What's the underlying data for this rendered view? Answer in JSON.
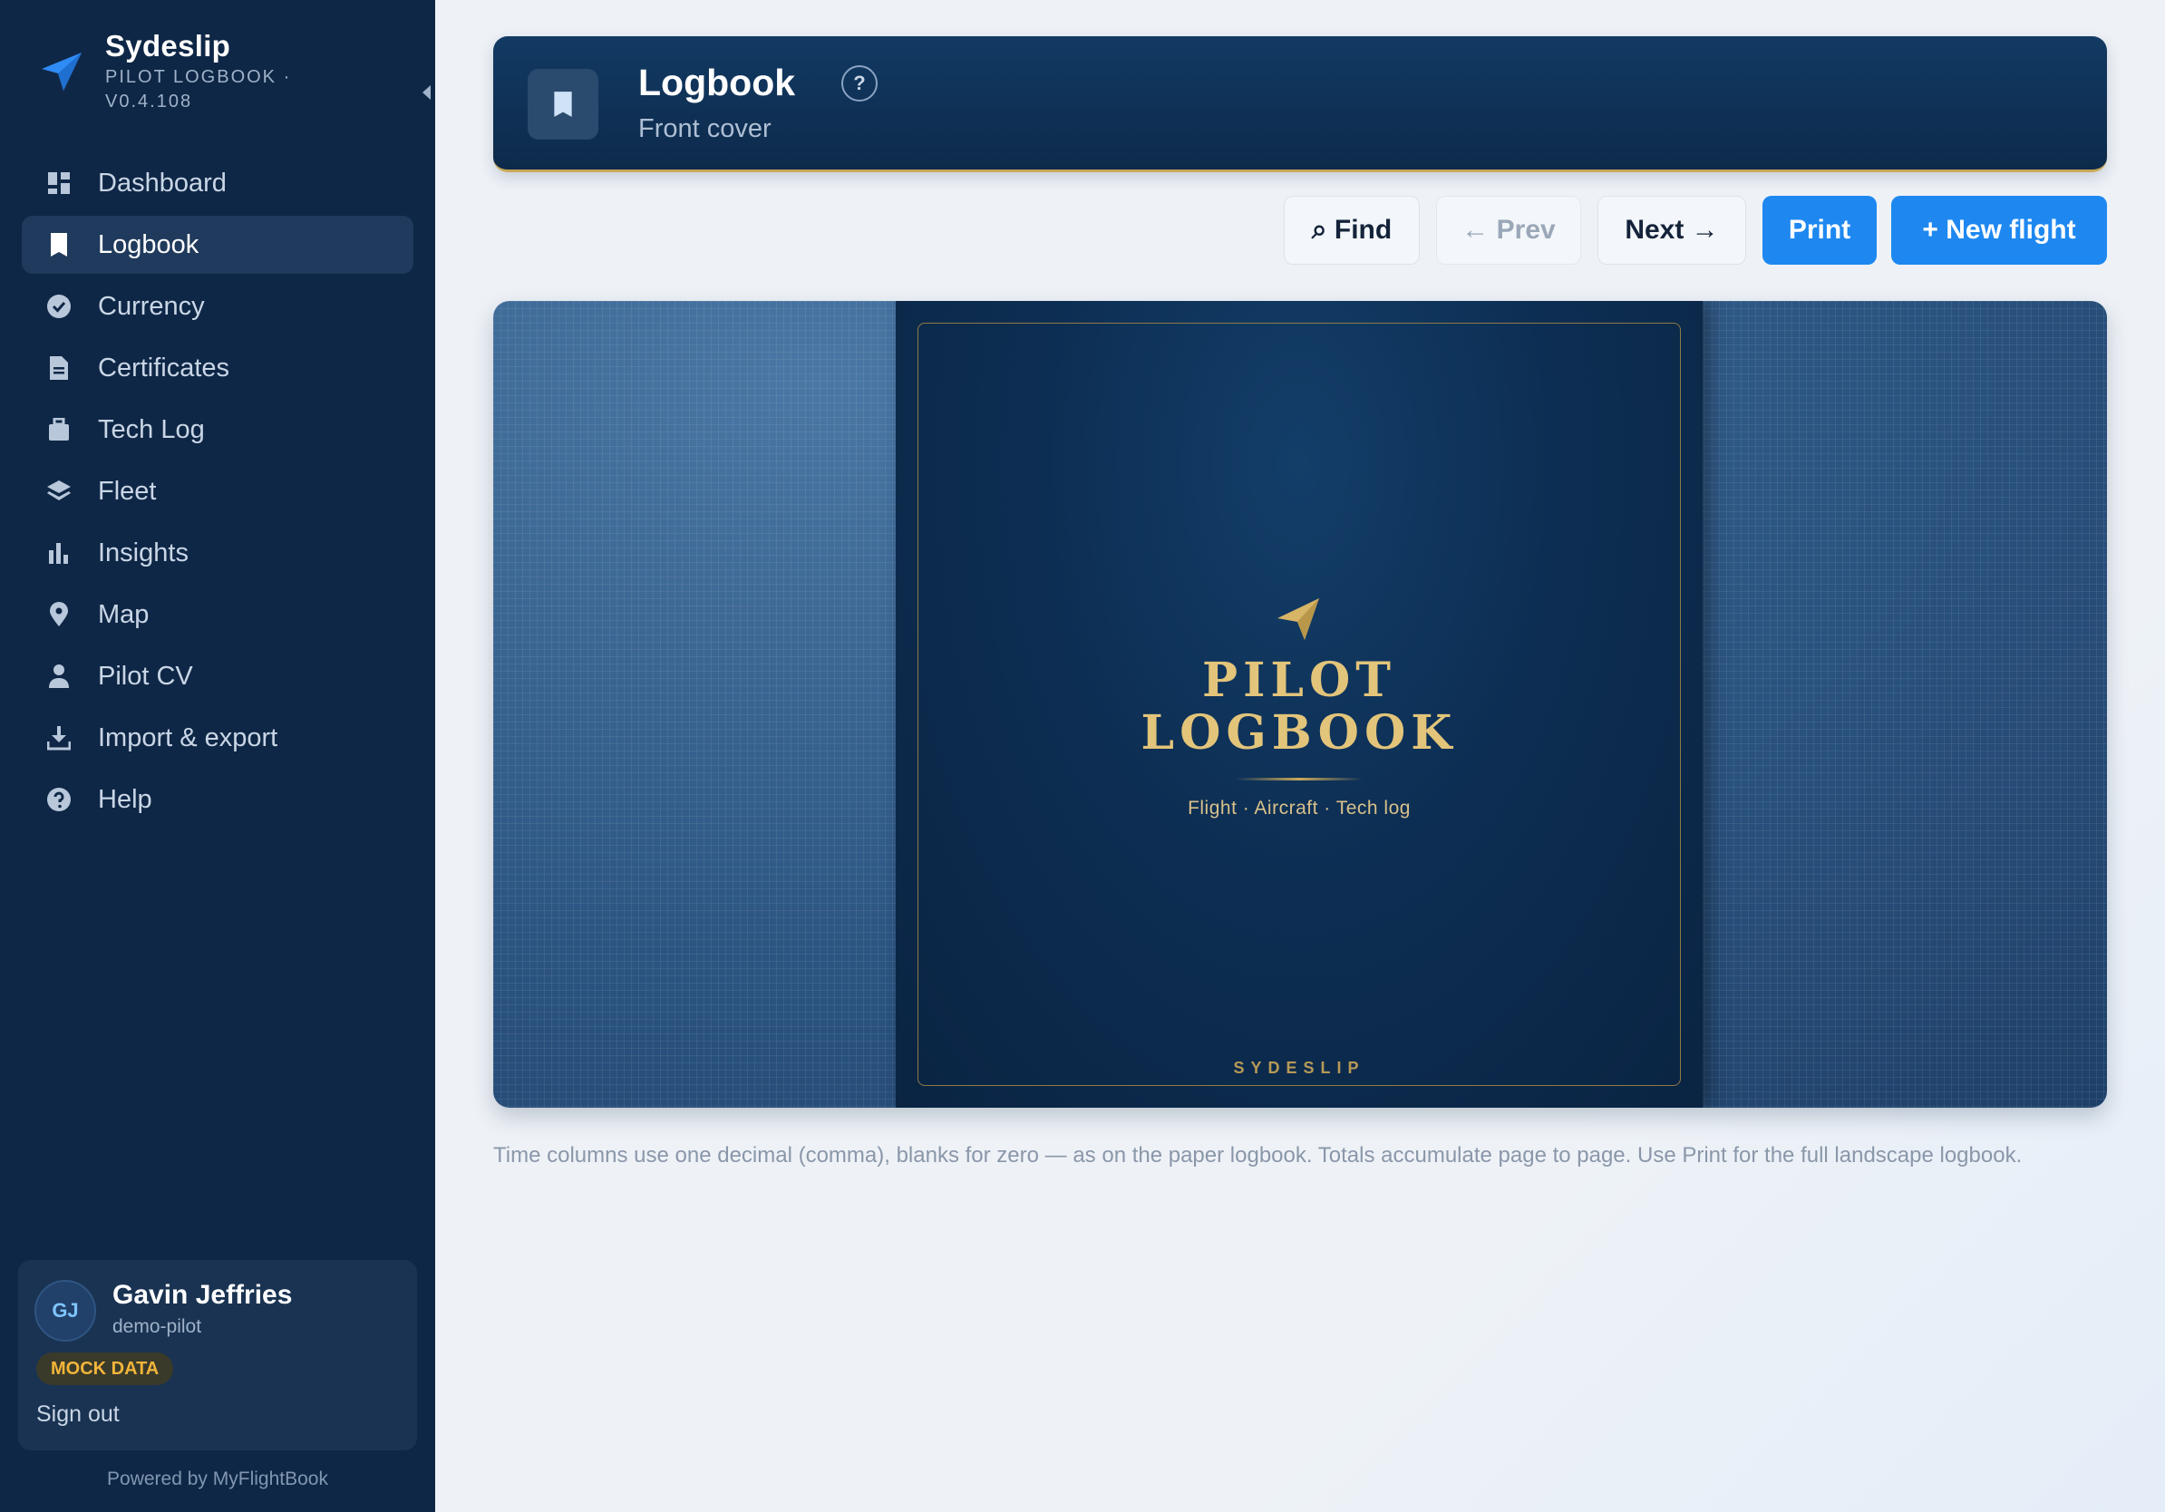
{
  "app": {
    "name": "Sydeslip",
    "subtitle": "PILOT LOGBOOK · V0.4.108",
    "powered_by": "Powered by MyFlightBook"
  },
  "sidebar": {
    "items": [
      {
        "label": "Dashboard",
        "icon": "dashboard-icon",
        "active": false
      },
      {
        "label": "Logbook",
        "icon": "book-icon",
        "active": true
      },
      {
        "label": "Currency",
        "icon": "check-circle-icon",
        "active": false
      },
      {
        "label": "Certificates",
        "icon": "document-icon",
        "active": false
      },
      {
        "label": "Tech Log",
        "icon": "briefcase-icon",
        "active": false
      },
      {
        "label": "Fleet",
        "icon": "layers-icon",
        "active": false
      },
      {
        "label": "Insights",
        "icon": "bar-chart-icon",
        "active": false
      },
      {
        "label": "Map",
        "icon": "map-pin-icon",
        "active": false
      },
      {
        "label": "Pilot CV",
        "icon": "person-icon",
        "active": false
      },
      {
        "label": "Import & export",
        "icon": "download-icon",
        "active": false
      },
      {
        "label": "Help",
        "icon": "help-circle-icon",
        "active": false
      }
    ]
  },
  "user": {
    "initials": "GJ",
    "name": "Gavin Jeffries",
    "handle": "demo-pilot",
    "badge": "MOCK DATA",
    "signout": "Sign out"
  },
  "header": {
    "title": "Logbook",
    "help": "?",
    "subtitle": "Front cover"
  },
  "toolbar": {
    "find": "⌕ Find",
    "prev": "← Prev",
    "next": "Next →",
    "print": "Print",
    "new_flight": "+ New flight"
  },
  "cover": {
    "title_line1": "PILOT",
    "title_line2": "LOGBOOK",
    "tagline": "Flight · Aircraft · Tech log",
    "footer": "SYDESLIP"
  },
  "footnote": "Time columns use one decimal (comma), blanks for zero — as on the paper logbook. Totals accumulate page to page. Use Print for the full landscape logbook.",
  "colors": {
    "sidebar_bg": "#0f2746",
    "accent": "#1e88f0",
    "gold": "#e2c47a",
    "badge_text": "#f2b53a"
  }
}
